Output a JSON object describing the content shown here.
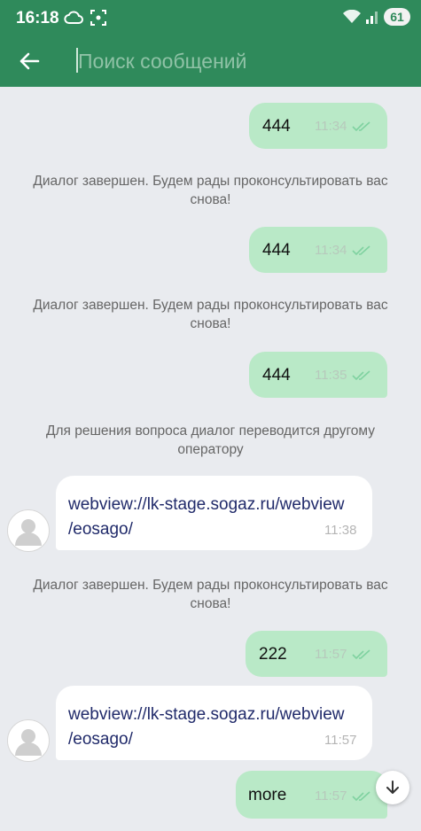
{
  "status_bar": {
    "time": "16:18",
    "battery": "61"
  },
  "search": {
    "placeholder": "Поиск сообщений",
    "value": ""
  },
  "messages": [
    {
      "type": "outgoing",
      "text": "444",
      "time": "11:34",
      "read": true
    },
    {
      "type": "system",
      "text": "Диалог завершен. Будем рады проконсультировать вас снова!"
    },
    {
      "type": "outgoing",
      "text": "444",
      "time": "11:34",
      "read": true
    },
    {
      "type": "system",
      "text": "Диалог завершен. Будем рады проконсультировать вас снова!"
    },
    {
      "type": "outgoing",
      "text": "444",
      "time": "11:35",
      "read": true
    },
    {
      "type": "system",
      "text": "Для решения вопроса диалог переводится другому оператору"
    },
    {
      "type": "incoming",
      "line1": "webview://lk-stage.sogaz.ru/webview",
      "line2": "/eosago/",
      "time": "11:38"
    },
    {
      "type": "system",
      "text": "Диалог завершен. Будем рады проконсультировать вас снова!"
    },
    {
      "type": "outgoing",
      "text": "222",
      "time": "11:57",
      "read": true
    },
    {
      "type": "incoming",
      "line1": "webview://lk-stage.sogaz.ru/webview",
      "line2": "/eosago/",
      "time": "11:57"
    },
    {
      "type": "outgoing",
      "text": "more",
      "time": "11:57",
      "read": true
    }
  ],
  "icons": {
    "back": "arrow-left-icon",
    "read": "double-check-icon",
    "avatar": "user-avatar-icon",
    "scroll": "arrow-down-icon"
  },
  "colors": {
    "header": "#2f8a5b",
    "outgoing_bubble": "#b9e9c7",
    "background": "#e9ebef",
    "link": "#202a6a"
  }
}
